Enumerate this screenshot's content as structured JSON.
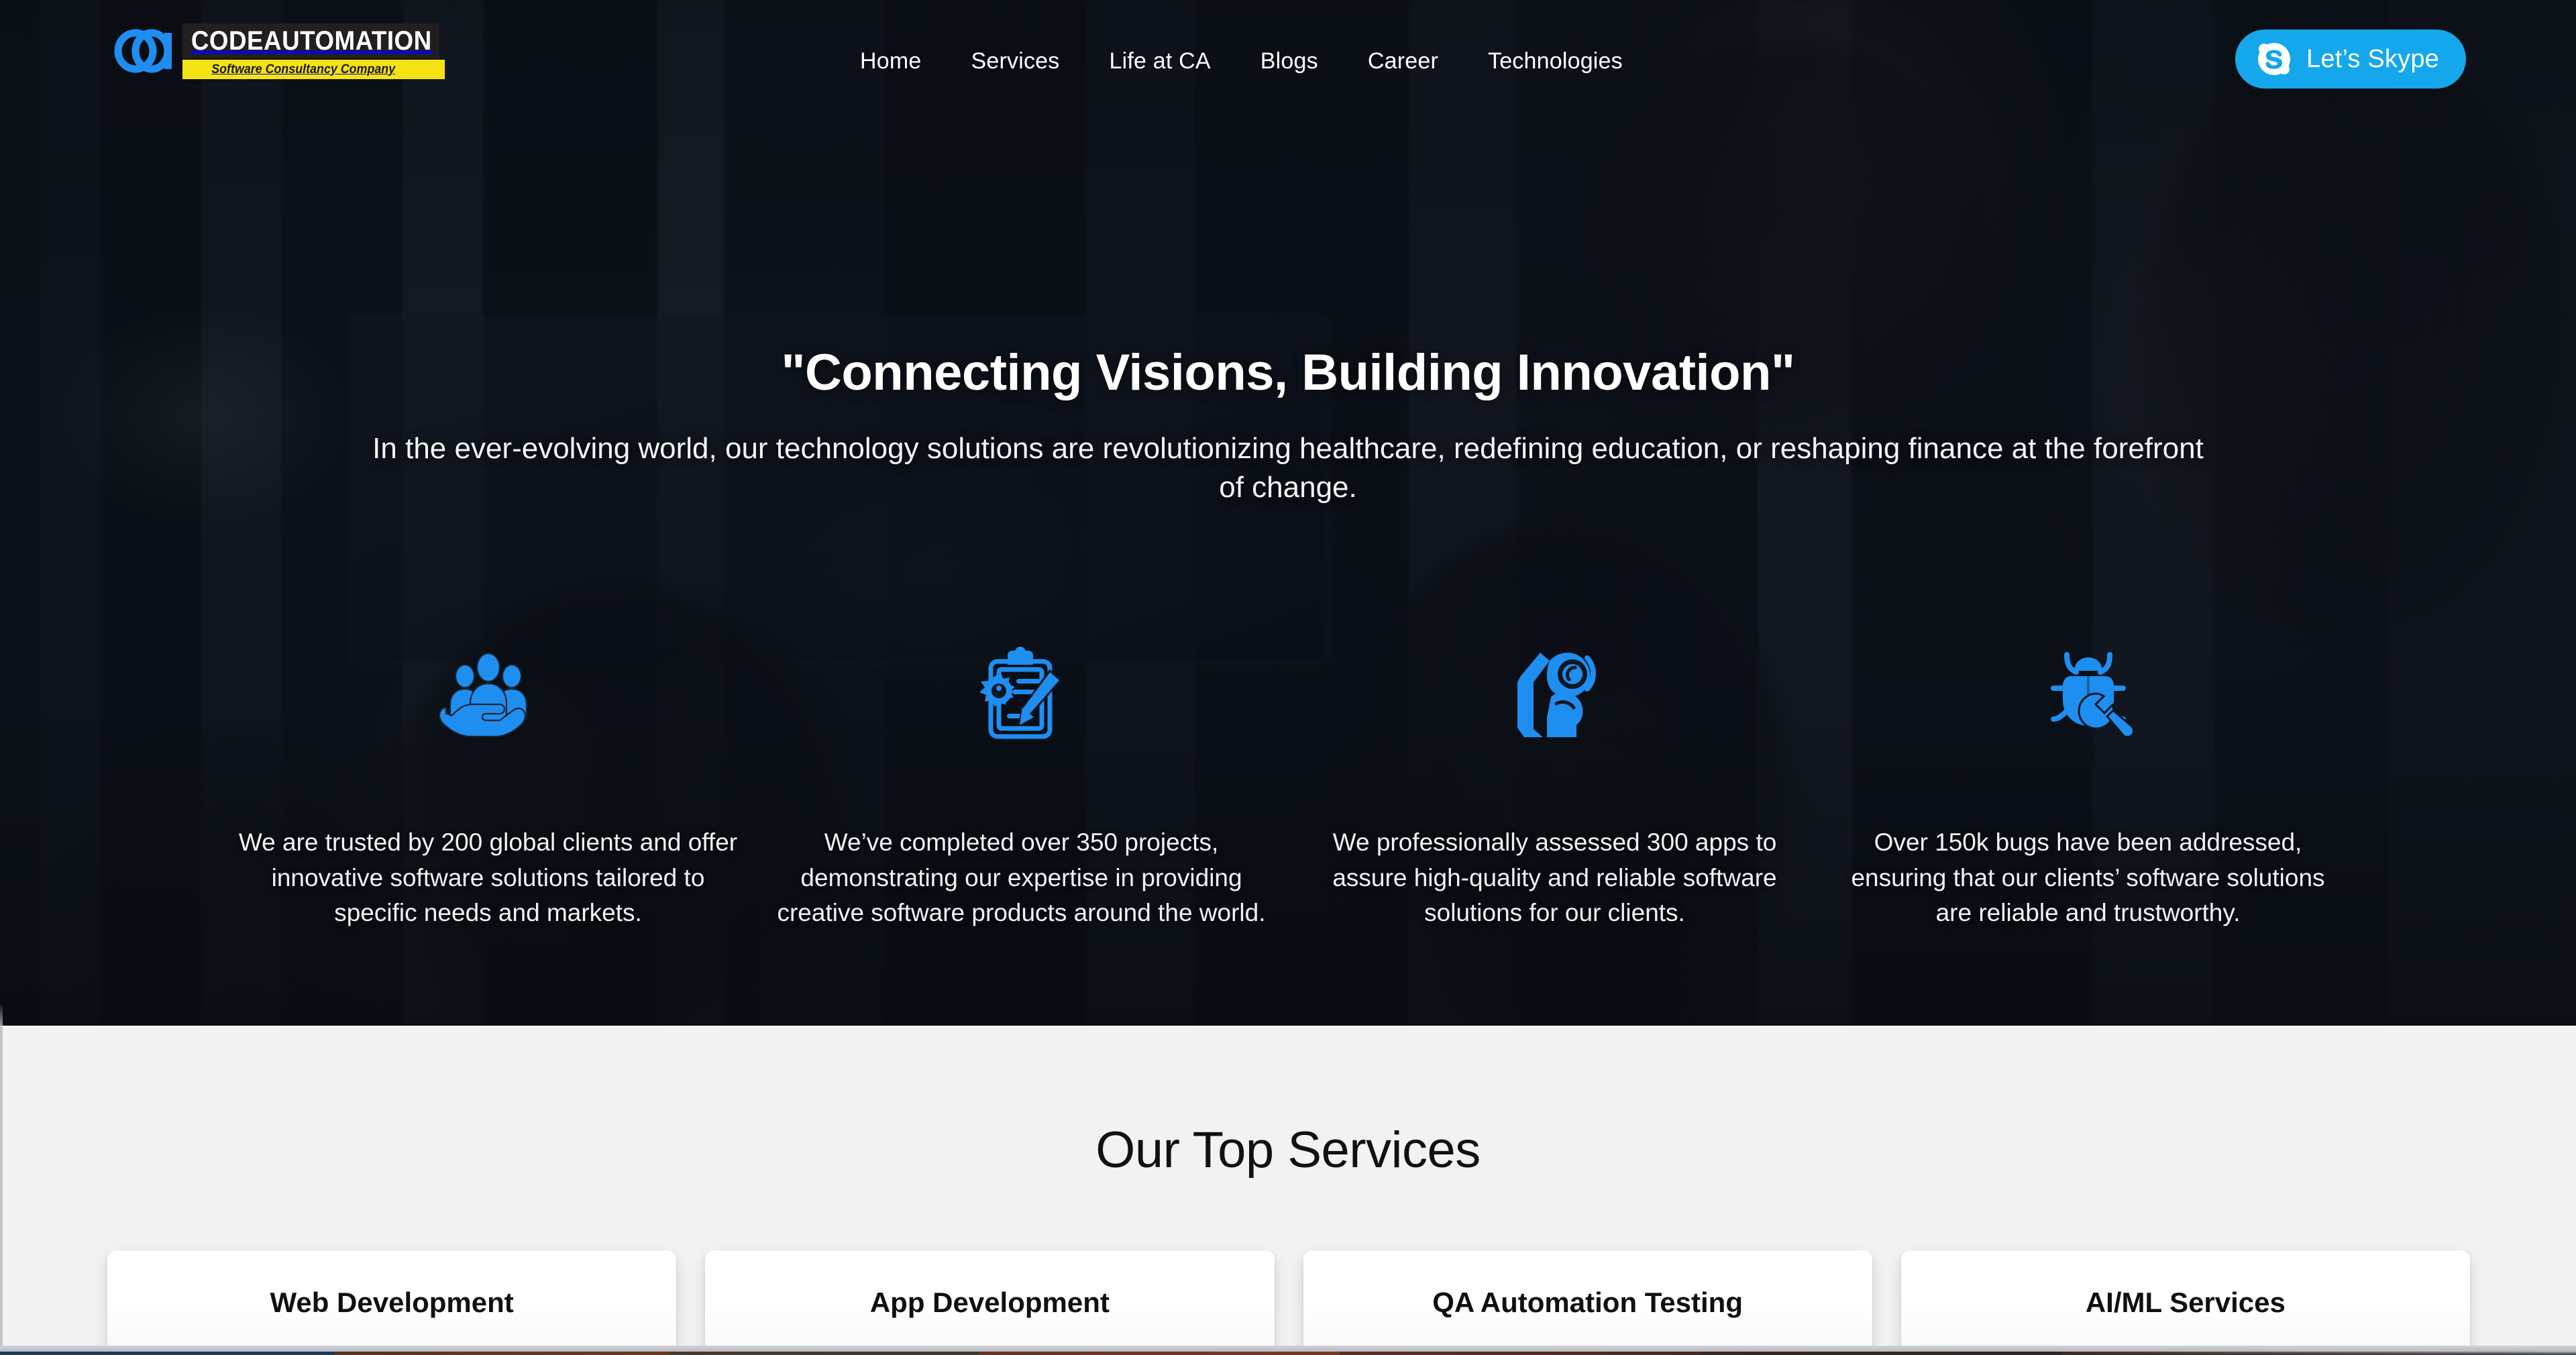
{
  "brand": {
    "logo_mark_icon": "ca-monogram-icon",
    "name": "CODEAUTOMATION",
    "tagline": "Software Consultancy Company",
    "accent_blue": "#1f8ef1",
    "logo_yellow": "#f5e214",
    "logo_dark": "#231f20"
  },
  "nav": {
    "items": [
      {
        "label": "Home"
      },
      {
        "label": "Services"
      },
      {
        "label": "Life at CA"
      },
      {
        "label": "Blogs"
      },
      {
        "label": "Career"
      },
      {
        "label": "Technologies"
      }
    ]
  },
  "skype": {
    "label": "Let’s Skype",
    "icon": "skype-icon",
    "background": "#14a7ec"
  },
  "hero": {
    "title": "\"Connecting Visions, Building Innovation\"",
    "subtitle": "In the ever-evolving world, our technology solutions are revolutionizing healthcare, redefining education, or reshaping finance at the forefront of change.",
    "features": [
      {
        "icon": "people-in-hand-icon",
        "text": "We are trusted by 200 global clients and offer innovative software solutions tailored to specific needs and markets."
      },
      {
        "icon": "clipboard-gear-pencil-icon",
        "text": "We’ve completed over 350 projects, demonstrating our expertise in providing creative software products around the world."
      },
      {
        "icon": "app-inspection-hand-icon",
        "text": "We professionally assessed 300 apps to assure high-quality and reliable software solutions for our clients."
      },
      {
        "icon": "bug-wrench-icon",
        "text": "Over 150k bugs have been addressed, ensuring that our clients’ software solutions are reliable and trustworthy."
      }
    ]
  },
  "services": {
    "heading": "Our Top Services",
    "background": "#f2f2f3",
    "cards": [
      {
        "label": "Web Development"
      },
      {
        "label": "App Development"
      },
      {
        "label": "QA Automation Testing"
      },
      {
        "label": "AI/ML Services"
      }
    ]
  }
}
